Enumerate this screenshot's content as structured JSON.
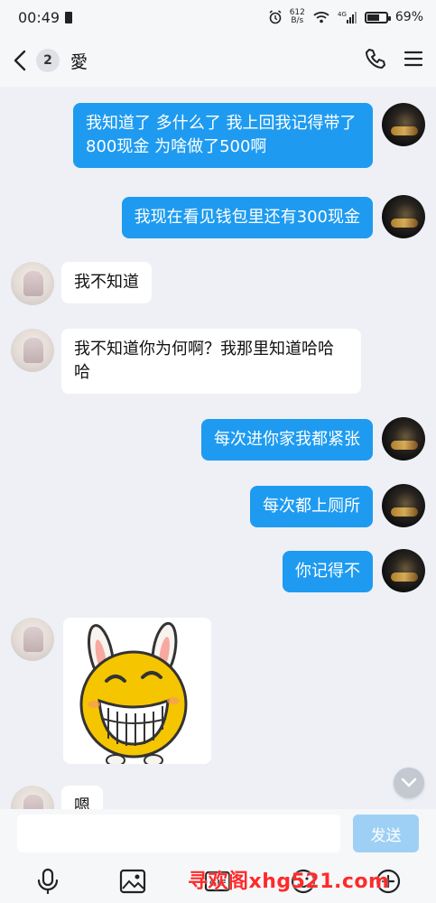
{
  "status_bar": {
    "time": "00:49",
    "net_speed_value": "612",
    "net_speed_unit": "B/s",
    "battery": "69%",
    "icons": [
      "sim-icon",
      "alarm-icon",
      "wifi-icon",
      "signal-4g-icon",
      "battery-icon"
    ]
  },
  "header": {
    "unread_count": "2",
    "title": "愛",
    "icons": [
      "back-icon",
      "phone-icon",
      "menu-icon"
    ]
  },
  "messages": [
    {
      "from": "me",
      "text": "我知道了  多什么了  我上回我记得带了800现金  为啥做了500啊"
    },
    {
      "from": "me",
      "text": "我现在看见钱包里还有300现金"
    },
    {
      "from": "other",
      "text": "我不知道"
    },
    {
      "from": "other",
      "text": "我不知道你为何啊？我那里知道哈哈哈"
    },
    {
      "from": "me",
      "text": "每次进你家我都紧张"
    },
    {
      "from": "me",
      "text": "每次都上厕所"
    },
    {
      "from": "me",
      "text": "你记得不"
    },
    {
      "from": "other",
      "type": "sticker",
      "sticker": "laughing-bunny-emoji"
    },
    {
      "from": "other",
      "text": "嗯"
    }
  ],
  "input": {
    "placeholder": "",
    "send_label": "发送"
  },
  "toolbar": {
    "icons": [
      "microphone-icon",
      "image-icon",
      "gif-icon",
      "emoji-icon",
      "plus-icon"
    ]
  },
  "watermark": "寻欢阁xhg521.com",
  "colors": {
    "my_bubble": "#1e9bf0",
    "other_bubble": "#ffffff",
    "chat_background": "#eef0f5",
    "send_button": "#9ed0f5",
    "watermark": "#ff2a2a"
  }
}
